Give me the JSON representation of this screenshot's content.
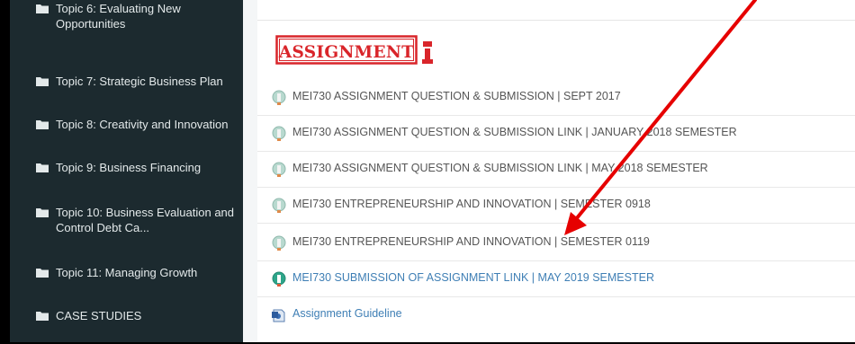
{
  "sidebar": {
    "items": [
      {
        "label": "Topic 6: Evaluating New Opportunities"
      },
      {
        "label": "Topic 7: Strategic Business Plan"
      },
      {
        "label": "Topic 8: Creativity and Innovation"
      },
      {
        "label": "Topic 9: Business Financing"
      },
      {
        "label": "Topic 10: Business Evaluation and Control Debt Ca..."
      },
      {
        "label": "Topic 11: Managing Growth"
      },
      {
        "label": "CASE STUDIES"
      }
    ]
  },
  "main": {
    "section_stamp": "ASSIGNMENT",
    "activities": [
      {
        "label": "MEI730 ASSIGNMENT QUESTION & SUBMISSION | SEPT 2017",
        "icon": "quiz-icon"
      },
      {
        "label": "MEI730 ASSIGNMENT QUESTION & SUBMISSION LINK | JANUARY 2018 SEMESTER",
        "icon": "quiz-icon"
      },
      {
        "label": "MEI730 ASSIGNMENT QUESTION & SUBMISSION LINK | MAY 2018 SEMESTER",
        "icon": "quiz-icon"
      },
      {
        "label": "MEI730 ENTREPRENEURSHIP AND INNOVATION | SEMESTER 0918",
        "icon": "quiz-icon"
      },
      {
        "label": "MEI730 ENTREPRENEURSHIP AND INNOVATION | SEMESTER 0119",
        "icon": "quiz-icon"
      },
      {
        "label": "MEI730 SUBMISSION OF ASSIGNMENT LINK | MAY 2019 SEMESTER",
        "icon": "assignment-icon"
      },
      {
        "label": "Assignment Guideline",
        "icon": "file-icon"
      }
    ]
  },
  "colors": {
    "sidebar_bg": "#1c2a2f",
    "link": "#3f7fb5",
    "stamp_red": "#d9252a",
    "annotation_arrow": "#e60000"
  }
}
